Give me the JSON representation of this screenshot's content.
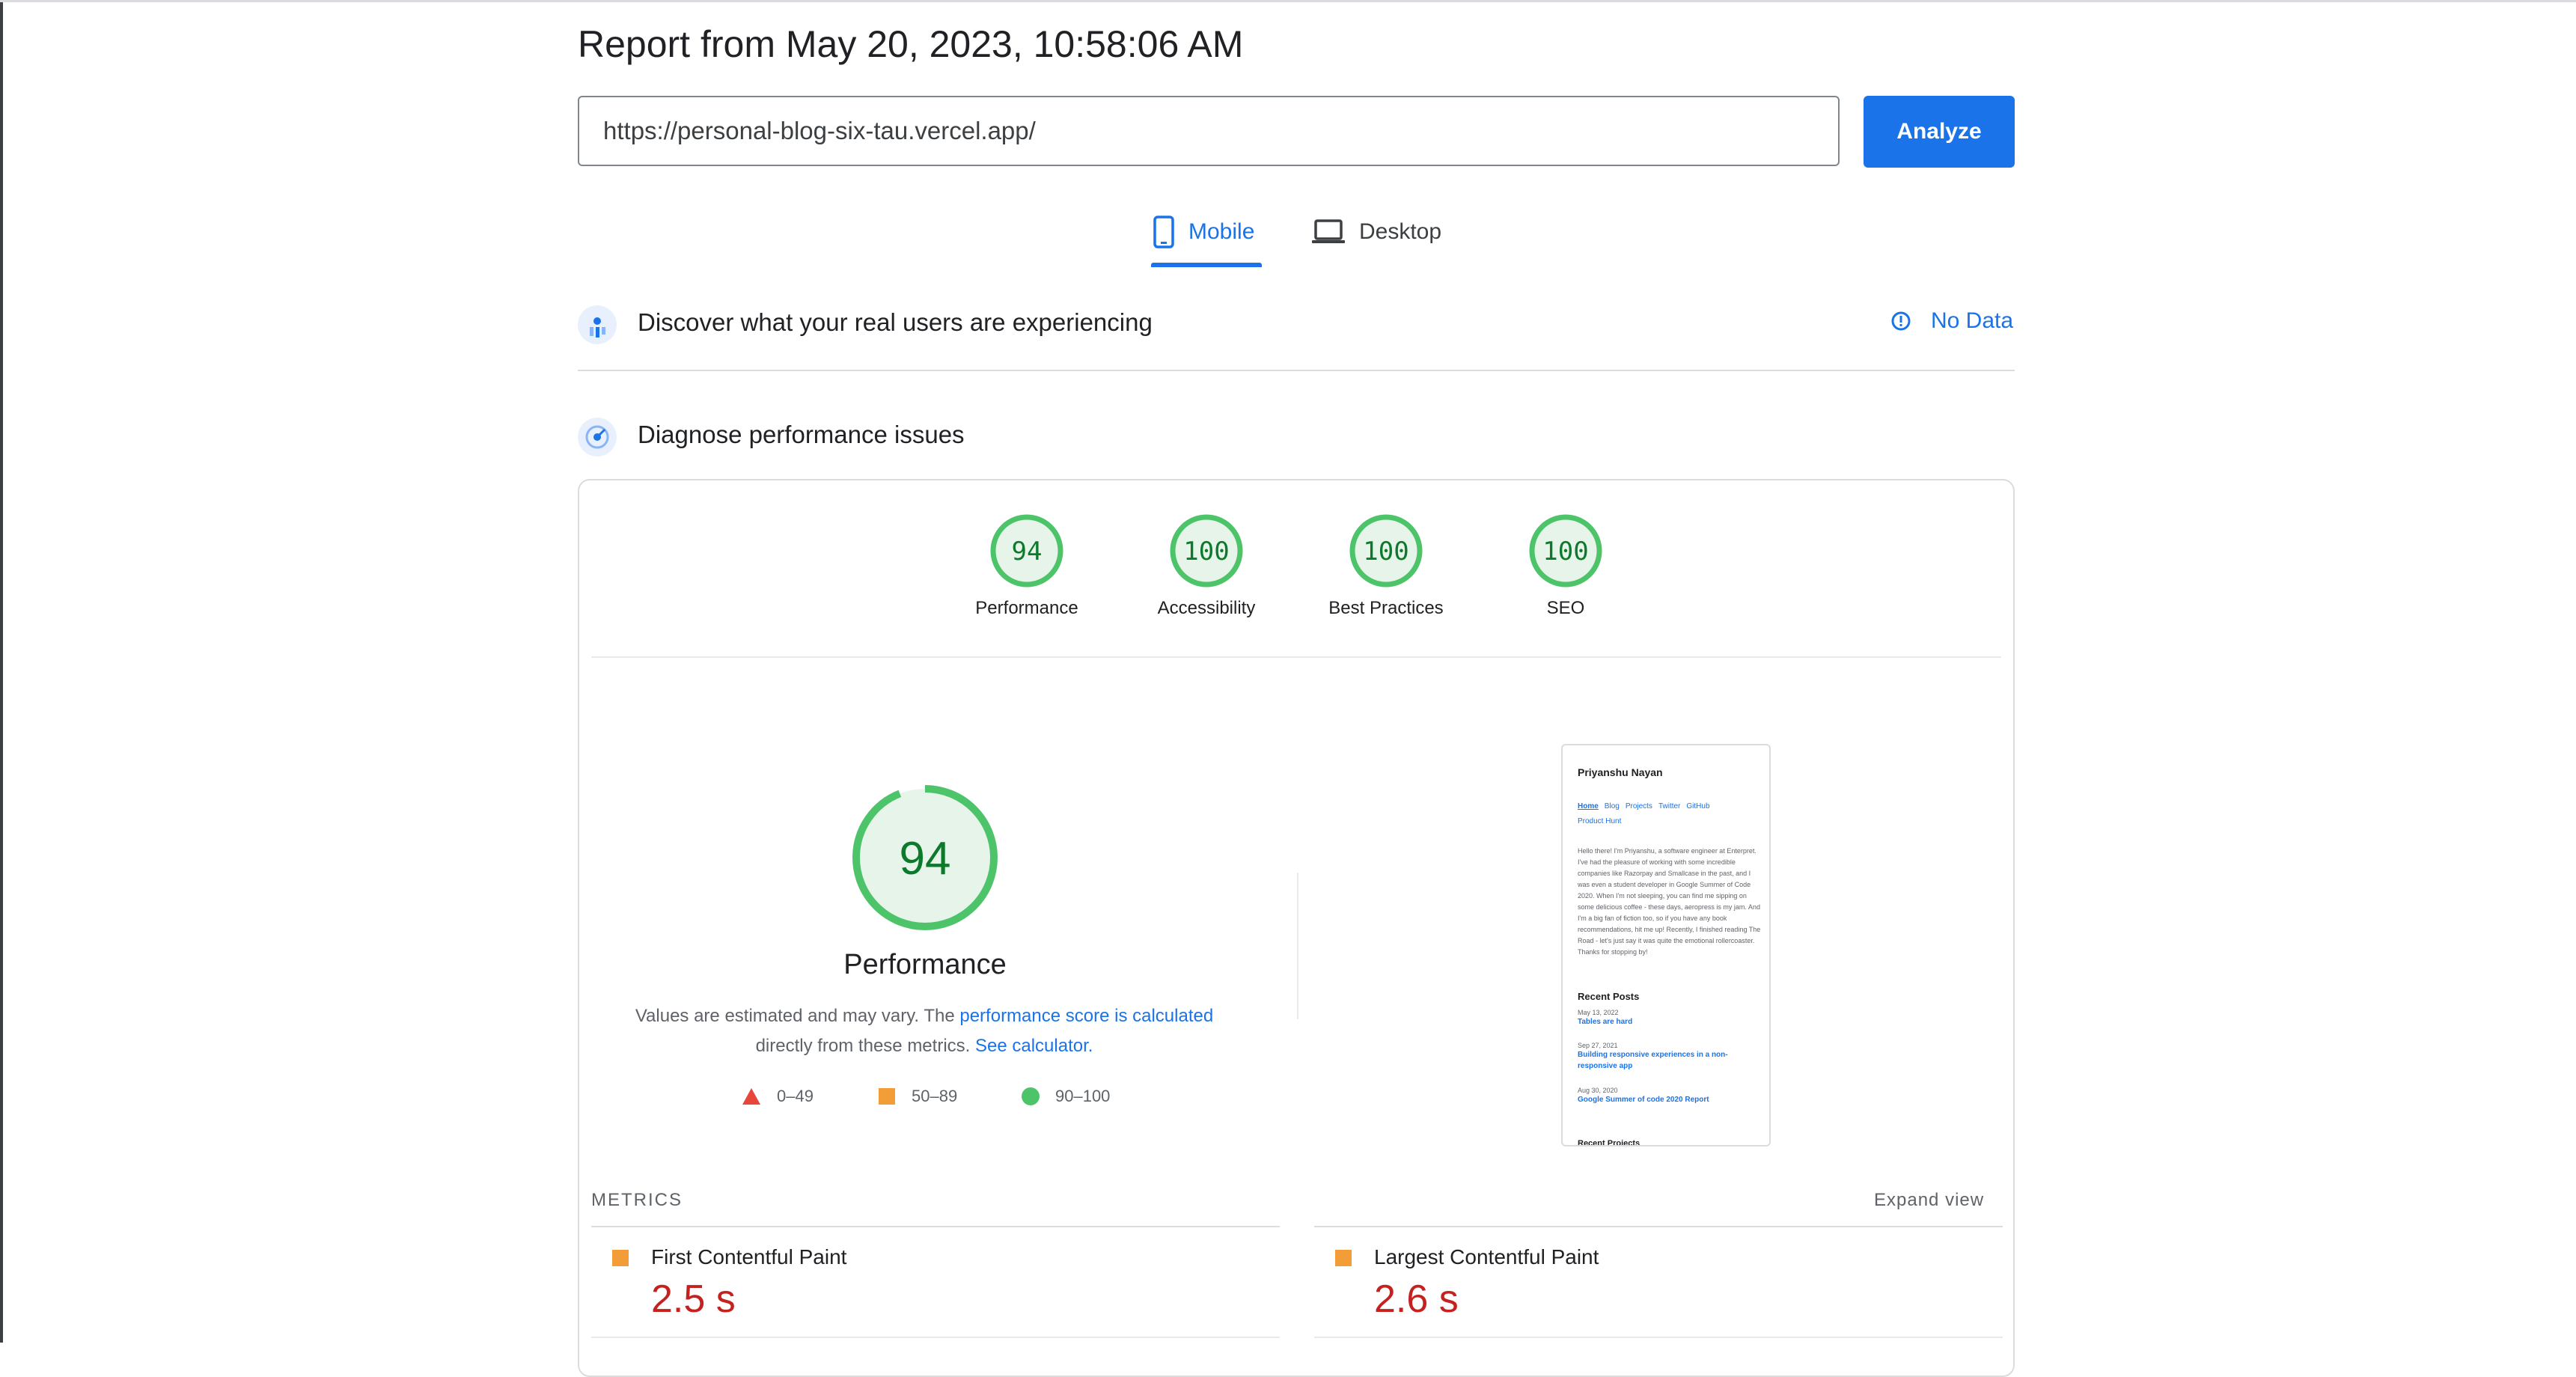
{
  "report": {
    "title": "Report from May 20, 2023, 10:58:06 AM",
    "url_value": "https://personal-blog-six-tau.vercel.app/",
    "analyze_label": "Analyze"
  },
  "tabs": [
    {
      "label": "Mobile",
      "icon": "phone-icon",
      "active": true
    },
    {
      "label": "Desktop",
      "icon": "laptop-icon",
      "active": false
    }
  ],
  "field_data": {
    "title": "Discover what your real users are experiencing",
    "status": "No Data"
  },
  "diagnose": {
    "title": "Diagnose performance issues"
  },
  "scores": [
    {
      "label": "Performance",
      "value": "94"
    },
    {
      "label": "Accessibility",
      "value": "100"
    },
    {
      "label": "Best Practices",
      "value": "100"
    },
    {
      "label": "SEO",
      "value": "100"
    }
  ],
  "performance": {
    "score": "94",
    "title": "Performance",
    "desc_prefix": "Values are estimated and may vary. The ",
    "desc_link1": "performance score is calculated",
    "desc_middle": "directly from these metrics. ",
    "desc_link2": "See calculator.",
    "legend": [
      {
        "shape": "triangle",
        "color": "#e8453c",
        "range": "0–49"
      },
      {
        "shape": "square",
        "color": "#f29d38",
        "range": "50–89"
      },
      {
        "shape": "circle",
        "color": "#4ec46a",
        "range": "90–100"
      }
    ]
  },
  "preview": {
    "name": "Priyanshu Nayan",
    "nav": [
      "Home",
      "Blog",
      "Projects",
      "Twitter",
      "GitHub",
      "Product Hunt"
    ],
    "bio": "Hello there! I'm Priyanshu, a software engineer at Enterpret. I've had the pleasure of working with some incredible companies like Razorpay and Smallcase in the past, and I was even a student developer in Google Summer of Code 2020. When I'm not sleeping, you can find me sipping on some delicious coffee - these days, aeropress is my jam. And I'm a big fan of fiction too, so if you have any book recommendations, hit me up! Recently, I finished reading The Road - let's just say it was quite the emotional rollercoaster. Thanks for stopping by!",
    "recent_heading": "Recent Posts",
    "posts": [
      {
        "date": "May 13, 2022",
        "title": "Tables are hard"
      },
      {
        "date": "Sep 27, 2021",
        "title": "Building responsive experiences in a non-responsive app"
      },
      {
        "date": "Aug 30, 2020",
        "title": "Google Summer of code 2020 Report"
      }
    ],
    "cutoff_heading": "Recent Projects"
  },
  "metrics": {
    "heading": "METRICS",
    "expand_label": "Expand view",
    "items": [
      {
        "name": "First Contentful Paint",
        "value": "2.5 s"
      },
      {
        "name": "Largest Contentful Paint",
        "value": "2.6 s"
      }
    ]
  },
  "colors": {
    "accent": "#1a73e8",
    "pass": "#0c7a2a",
    "pass_ring": "#4ec46a",
    "average": "#f29d38",
    "fail_value": "#c5221f"
  }
}
